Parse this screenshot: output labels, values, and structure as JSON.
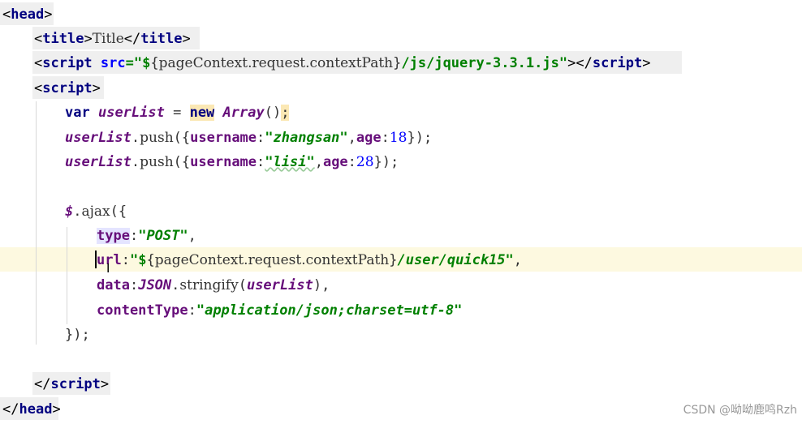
{
  "code": {
    "l1": {
      "open": "<",
      "tag": "head",
      "close": ">"
    },
    "l2": {
      "open1": "<",
      "tag1": "title",
      "close1": ">",
      "text": "Title",
      "open2": "</",
      "tag2": "title",
      "close2": ">"
    },
    "l3": {
      "open1": "<",
      "tag1": "script",
      "sp": " ",
      "attr": "src",
      "eq_q": "=\"",
      "dollar": "$",
      "brace_open": "{",
      "el": "pageContext.request.contextPath",
      "brace_close": "}",
      "path": "/js/jquery-3.3.1.js",
      "end_q": "\"",
      "close1": ">",
      "open2": "</",
      "tag2": "script",
      "close2": ">"
    },
    "l4": {
      "open": "<",
      "tag": "script",
      "close": ">"
    },
    "l5": {
      "kw_var": "var",
      "sp1": " ",
      "name": "userList",
      "eq": " = ",
      "kw_new": "new",
      "sp2": " ",
      "cls": "Array",
      "parens": "()",
      "semi": ";"
    },
    "l6": {
      "name": "userList",
      "dot": ".",
      "method": "push",
      "open": "({",
      "k1": "username",
      "colon1": ":",
      "v1": "\"zhangsan\"",
      "comma": ",",
      "k2": "age",
      "colon2": ":",
      "n": "18",
      "close": "});"
    },
    "l7": {
      "name": "userList",
      "dot": ".",
      "method": "push",
      "open": "({",
      "k1": "username",
      "colon1": ":",
      "v1": "\"lisi\"",
      "comma": ",",
      "k2": "age",
      "colon2": ":",
      "n": "28",
      "close": "});"
    },
    "l8": {
      "dollar": "$",
      "dot": ".",
      "method": "ajax",
      "open": "({"
    },
    "l9": {
      "key": "type",
      "colon": ":",
      "val": "\"POST\"",
      "comma": ","
    },
    "l10": {
      "key": "url",
      "colon": ":",
      "q": "\"",
      "dollar": "$",
      "brace_open": "{",
      "el": "pageContext.request.contextPath",
      "brace_close": "}",
      "path": "/user/quick15\"",
      "comma": ","
    },
    "l11": {
      "key": "data",
      "colon": ":",
      "obj": "JSON",
      "dot": ".",
      "method": "stringify",
      "open": "(",
      "arg": "userList",
      "close": "),"
    },
    "l12": {
      "key": "contentType",
      "colon": ":",
      "val": "\"application/json;charset=utf-8\""
    },
    "l13": {
      "close": "});"
    },
    "l14": {
      "open": "</",
      "tag": "script",
      "close": ">"
    },
    "l15": {
      "open": "</",
      "tag": "head",
      "close": ">"
    }
  },
  "cursor": {
    "ibeam": "I"
  },
  "watermark": "CSDN @呦呦鹿鸣Rzh",
  "colors": {
    "tag": "#000080",
    "attribute": "#0000ff",
    "string": "#008000",
    "variable": "#660e7a",
    "caret_line": "#fdf9e0",
    "new_highlight": "#fbe8b4"
  }
}
